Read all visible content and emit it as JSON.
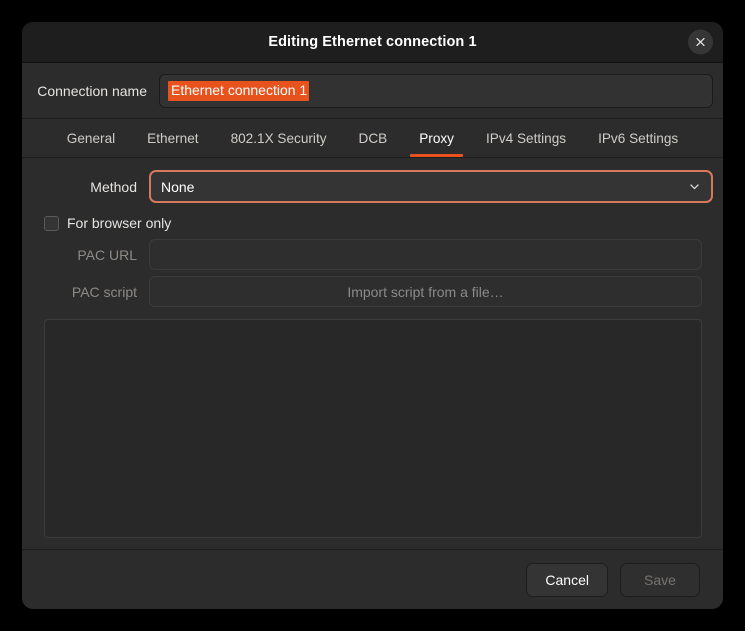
{
  "window": {
    "title": "Editing Ethernet connection 1",
    "close_icon": "close-icon"
  },
  "connection": {
    "label": "Connection name",
    "value": "Ethernet connection 1",
    "selection_color": "#e8521d"
  },
  "tabs": [
    {
      "label": "General",
      "active": false
    },
    {
      "label": "Ethernet",
      "active": false
    },
    {
      "label": "802.1X Security",
      "active": false
    },
    {
      "label": "DCB",
      "active": false
    },
    {
      "label": "Proxy",
      "active": true
    },
    {
      "label": "IPv4 Settings",
      "active": false
    },
    {
      "label": "IPv6 Settings",
      "active": false
    }
  ],
  "proxy": {
    "method": {
      "label": "Method",
      "value": "None",
      "chevron_icon": "chevron-down-icon",
      "focus_color": "#d4795a"
    },
    "browser_only": {
      "label": "For browser only",
      "checked": false
    },
    "pac_url": {
      "label": "PAC URL",
      "value": "",
      "placeholder": "",
      "enabled": false
    },
    "pac_script": {
      "label": "PAC script",
      "value": "",
      "placeholder": "Import script from a file…",
      "enabled": false
    },
    "script_text": ""
  },
  "actions": {
    "cancel_label": "Cancel",
    "save_label": "Save",
    "save_enabled": false
  }
}
